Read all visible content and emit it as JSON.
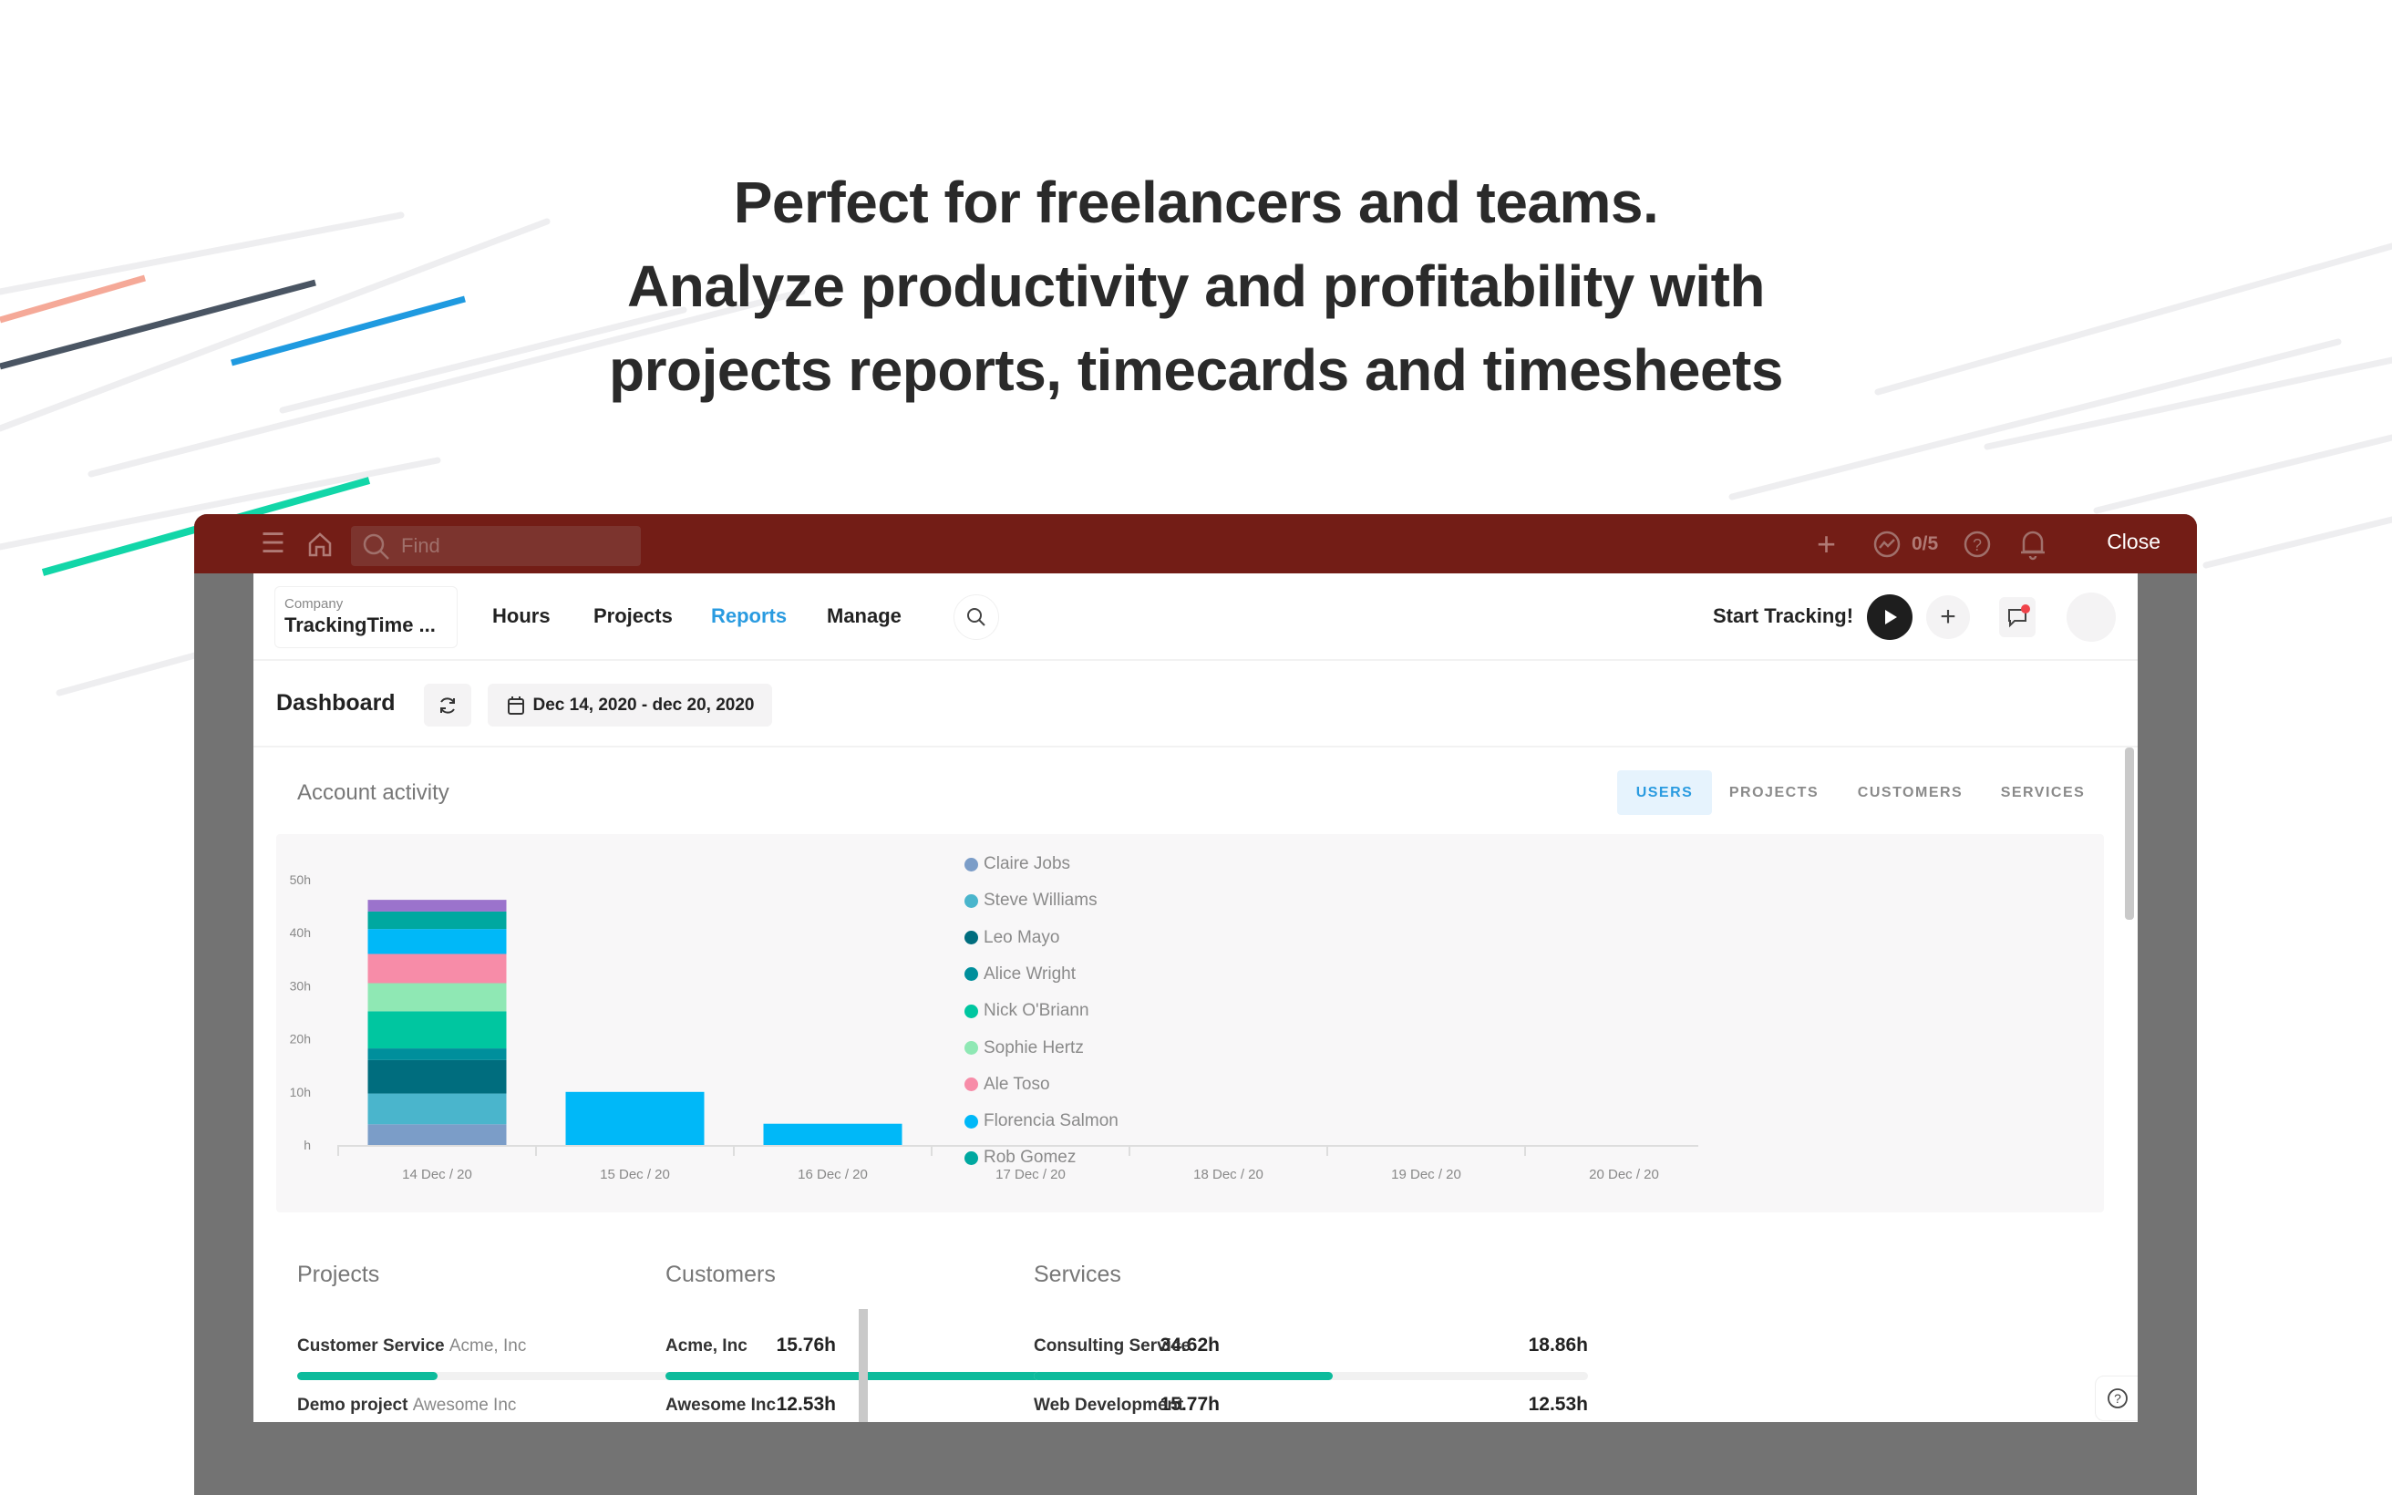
{
  "headline": [
    "Perfect for freelancers and teams.",
    "Analyze  productivity and profitability with",
    "projects reports, timecards and timesheets"
  ],
  "topbar": {
    "search_placeholder": "Find",
    "goals_count": "0/5",
    "close_label": "Close",
    "icons": [
      "menu-icon",
      "home-icon",
      "search-icon",
      "plus-icon",
      "trend-icon",
      "help-icon",
      "bell-icon"
    ]
  },
  "nav": {
    "company_label": "Company",
    "company_name": "TrackingTime ...",
    "items": [
      "Hours",
      "Projects",
      "Reports",
      "Manage"
    ],
    "active": "Reports",
    "start_tracking": "Start Tracking!"
  },
  "dashboard": {
    "title": "Dashboard",
    "date_range": "Dec 14, 2020 - dec 20, 2020"
  },
  "activity": {
    "title": "Account activity",
    "tabs": [
      "USERS",
      "PROJECTS",
      "CUSTOMERS",
      "SERVICES"
    ],
    "active_tab": "USERS"
  },
  "chart_data": {
    "type": "bar",
    "stacked": true,
    "categories": [
      "14 Dec / 20",
      "15 Dec / 20",
      "16 Dec / 20",
      "17 Dec / 20",
      "18 Dec / 20",
      "19 Dec / 20",
      "20 Dec / 20"
    ],
    "y_ticks": [
      "h",
      "10h",
      "20h",
      "30h",
      "40h",
      "50h"
    ],
    "ylim": [
      0,
      50
    ],
    "legend_position": "right",
    "series": [
      {
        "name": "Claire Jobs",
        "color": "#7b9dc8",
        "values": [
          3.9,
          0,
          0,
          0,
          0,
          0,
          0
        ]
      },
      {
        "name": "Steve Williams",
        "color": "#4ab5cc",
        "values": [
          5.8,
          0,
          0,
          0,
          0,
          0,
          0
        ]
      },
      {
        "name": "Leo Mayo",
        "color": "#006d7e",
        "values": [
          6.3,
          0,
          0,
          0,
          0,
          0,
          0
        ]
      },
      {
        "name": "Alice Wright",
        "color": "#008f9c",
        "values": [
          2.2,
          0,
          0,
          0,
          0,
          0,
          0
        ]
      },
      {
        "name": "Nick O'Briann",
        "color": "#00c6a0",
        "values": [
          7.0,
          0,
          0,
          0,
          0,
          0,
          0
        ]
      },
      {
        "name": "Sophie Hertz",
        "color": "#8fe8b4",
        "values": [
          5.3,
          0,
          0,
          0,
          0,
          0,
          0
        ]
      },
      {
        "name": "Ale Toso",
        "color": "#f78ca8",
        "values": [
          5.5,
          0,
          0,
          0,
          0,
          0,
          0
        ]
      },
      {
        "name": "Florencia Salmon",
        "color": "#00b8f8",
        "values": [
          4.7,
          10.0,
          4.0,
          0,
          0,
          0,
          0
        ]
      },
      {
        "name": "Rob Gomez",
        "color": "#00a8a0",
        "values": [
          3.3,
          0,
          0,
          0,
          0,
          0,
          0
        ]
      },
      {
        "color": "#9b73cc",
        "values": [
          2.2,
          0,
          0,
          0,
          0,
          0,
          0
        ]
      }
    ]
  },
  "summary": [
    {
      "title": "Projects",
      "rows": [
        {
          "label": "Customer Service",
          "sub": "Acme, Inc",
          "value": "15.76h",
          "fill": 0.26
        },
        {
          "label": "Demo project",
          "sub": "Awesome Inc",
          "value": "12.53h"
        }
      ]
    },
    {
      "title": "Customers",
      "rows": [
        {
          "label": "Acme, Inc",
          "sub": "",
          "value": "34.62h",
          "fill": 0.68
        },
        {
          "label": "Awesome Inc",
          "sub": "",
          "value": "15.77h"
        }
      ]
    },
    {
      "title": "Services",
      "rows": [
        {
          "label": "Consulting Service",
          "sub": "",
          "value": "18.86h",
          "fill": 0.54
        },
        {
          "label": "Web Development",
          "sub": "",
          "value": "12.53h"
        }
      ]
    }
  ],
  "colors": {
    "topbar": "#731d16",
    "accent": "#2a9be0",
    "progress": "#0dbb9c",
    "frame": "#737373"
  }
}
